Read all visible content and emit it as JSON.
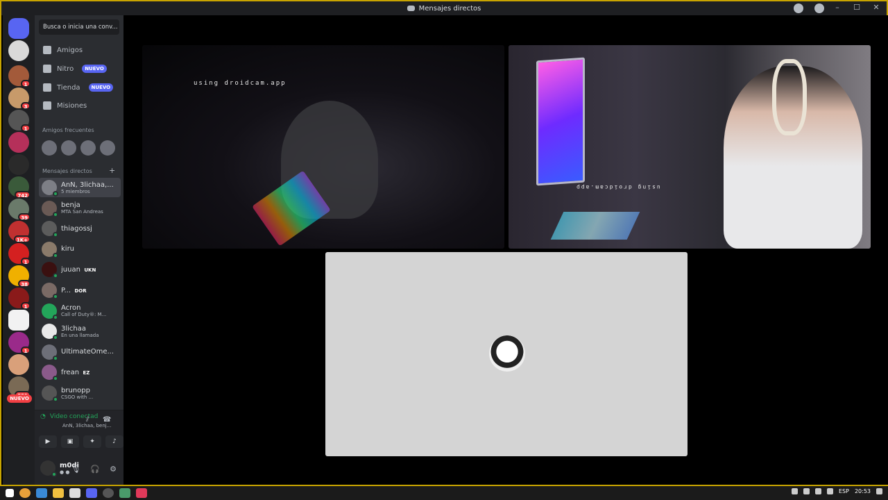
{
  "window": {
    "title": "Mensajes directos"
  },
  "search": {
    "placeholder": "Busca o inicia una conv..."
  },
  "nav": [
    {
      "label": "Amigos",
      "icon": "friends-icon",
      "badge": ""
    },
    {
      "label": "Nitro",
      "icon": "nitro-icon",
      "badge": "NUEVO"
    },
    {
      "label": "Tienda",
      "icon": "shop-icon",
      "badge": "NUEVO"
    },
    {
      "label": "Misiones",
      "icon": "quests-icon",
      "badge": ""
    }
  ],
  "sections": {
    "frequent": "Amigos frecuentes",
    "dms": "Mensajes directos"
  },
  "dms": [
    {
      "name": "AnN, 3lichaa,...",
      "sub": "5 miembros",
      "active": true,
      "color": "#7d7f86"
    },
    {
      "name": "benja",
      "sub": "MTA San Andreas",
      "active": false,
      "color": "#6a5a55"
    },
    {
      "name": "thiagossj",
      "sub": "",
      "active": false,
      "color": "#5c5c5c"
    },
    {
      "name": "kiru",
      "sub": "",
      "active": false,
      "color": "#8a7a6a"
    },
    {
      "name": "juuan",
      "sub": "",
      "pill": "UKN",
      "active": false,
      "color": "#3a1010"
    },
    {
      "name": "P...",
      "sub": "",
      "pill": "DOR",
      "active": false,
      "color": "#7a6a65"
    },
    {
      "name": "Acron",
      "sub": "Call of Duty®: M...",
      "active": false,
      "color": "#23a55a"
    },
    {
      "name": "3lichaa",
      "sub": "En una llamada",
      "active": false,
      "color": "#e9e9e9"
    },
    {
      "name": "UltimateOme...",
      "sub": "",
      "active": false,
      "color": "#6d6f78"
    },
    {
      "name": "frean",
      "sub": "",
      "pill": "EZ",
      "active": false,
      "color": "#8a5a8a"
    },
    {
      "name": "brunopp",
      "sub": "CSGO with ...",
      "active": false,
      "color": "#555"
    }
  ],
  "server_badges": [
    "1",
    "3",
    "1",
    "742",
    "39",
    "1K+",
    "1",
    "38",
    "1",
    "1",
    "321"
  ],
  "server_new": "NUEVO",
  "voice": {
    "status": "Video conectad",
    "sub": "AnN, 3lichaa, benj..."
  },
  "user": {
    "name": "m0di"
  },
  "stage": {
    "overlay_text": "using droidcam.app",
    "overlay_text_2": "using droidcam.app"
  },
  "taskbar": {
    "lang": "ESP",
    "time": "20:53"
  }
}
